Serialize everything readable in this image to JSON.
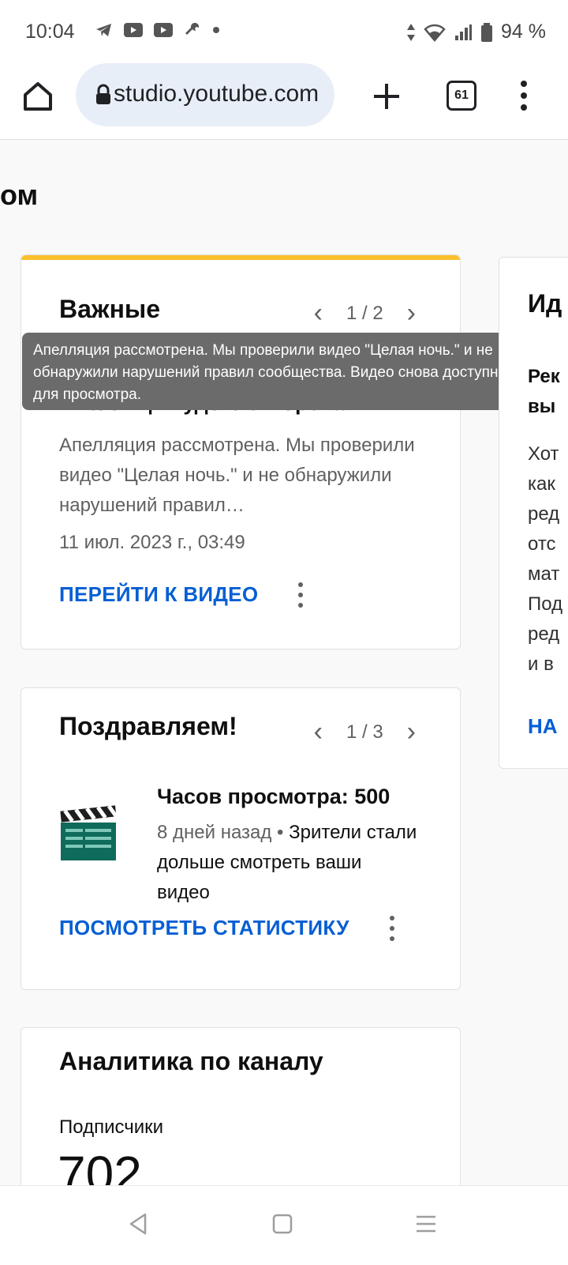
{
  "status_bar": {
    "time": "10:04",
    "battery": "94 %"
  },
  "browser": {
    "url": "studio.youtube.com",
    "tab_count": "61"
  },
  "page": {
    "title_partial": "ом"
  },
  "important_card": {
    "title": "Важные",
    "pager": "1 / 2",
    "subtitle": "Апелляция удовлетворена",
    "body": "Апелляция рассмотрена. Мы проверили видео \"Целая ночь.\" и не обнаружили нарушений правил…",
    "date": "11 июл. 2023 г., 03:49",
    "action": "ПЕРЕЙТИ К ВИДЕО"
  },
  "tooltip": {
    "text": "Апелляция рассмотрена. Мы проверили видео \"Целая ночь.\" и не обнаружили нарушений правил сообщества. Видео снова доступно для просмотра."
  },
  "congrats_card": {
    "title": "Поздравляем!",
    "pager": "1 / 3",
    "achievement_title": "Часов просмотра: 500",
    "time_ago": "8 дней назад",
    "separator": " • ",
    "achievement_text": "Зрители стали дольше смотреть ваши видео",
    "action": "ПОСМОТРЕТЬ СТАТИСТИКУ"
  },
  "analytics_card": {
    "title": "Аналитика по каналу",
    "subscribers_label": "Подписчики",
    "subscribers_value": "702"
  },
  "right_card": {
    "title_partial": "Ид",
    "subtitle_partial_1": "Рек",
    "subtitle_partial_2": "вы",
    "body_partial": [
      "Хот",
      "как",
      "ред",
      "отс",
      "мат",
      "Под",
      "ред",
      "и в"
    ],
    "link_partial": "НА"
  }
}
